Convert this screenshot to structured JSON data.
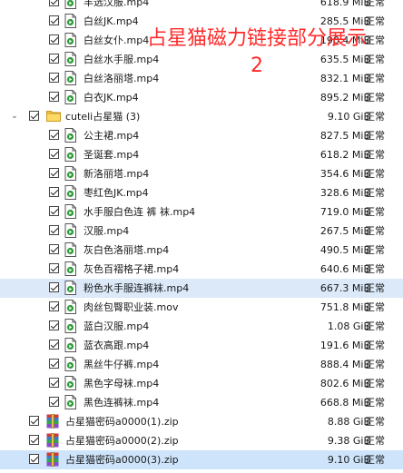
{
  "status_text": "正常",
  "watermark": {
    "line1": "占星猫磁力链接部分展示",
    "line2": "2"
  },
  "rows": [
    {
      "type": "file",
      "name": "丰选汉服.mp4",
      "size": "618.9 MiB"
    },
    {
      "type": "file",
      "name": "白丝JK.mp4",
      "size": "285.5 MiB"
    },
    {
      "type": "file",
      "name": "白丝女仆.mp4",
      "size": "190.4 MiB"
    },
    {
      "type": "file",
      "name": "白丝水手服.mp4",
      "size": "635.5 MiB"
    },
    {
      "type": "file",
      "name": "白丝洛丽塔.mp4",
      "size": "832.1 MiB"
    },
    {
      "type": "file",
      "name": "白衣JK.mp4",
      "size": "895.2 MiB"
    },
    {
      "type": "folder",
      "name": "cuteli占星猫 (3)",
      "size": "9.10 GiB"
    },
    {
      "type": "file",
      "name": "公主裙.mp4",
      "size": "827.5 MiB"
    },
    {
      "type": "file",
      "name": "圣诞套.mp4",
      "size": "618.2 MiB"
    },
    {
      "type": "file",
      "name": "新洛丽塔.mp4",
      "size": "354.6 MiB"
    },
    {
      "type": "file",
      "name": "枣红色JK.mp4",
      "size": "328.6 MiB"
    },
    {
      "type": "file",
      "name": "水手服白色连 裤 袜.mp4",
      "size": "719.0 MiB"
    },
    {
      "type": "file",
      "name": "汉服.mp4",
      "size": "267.5 MiB"
    },
    {
      "type": "file",
      "name": "灰白色洛丽塔.mp4",
      "size": "490.5 MiB"
    },
    {
      "type": "file",
      "name": "灰色百褶格子裙.mp4",
      "size": "640.6 MiB"
    },
    {
      "type": "file",
      "name": "粉色水手服连裤袜.mp4",
      "size": "667.3 MiB",
      "highlight": true
    },
    {
      "type": "file",
      "name": "肉丝包臀职业装.mov",
      "size": "751.8 MiB"
    },
    {
      "type": "file",
      "name": "蓝白汉服.mp4",
      "size": "1.08 GiB"
    },
    {
      "type": "file",
      "name": "蓝衣高跟.mp4",
      "size": "191.6 MiB"
    },
    {
      "type": "file",
      "name": "黑丝牛仔裤.mp4",
      "size": "888.4 MiB"
    },
    {
      "type": "file",
      "name": "黑色字母袜.mp4",
      "size": "802.6 MiB"
    },
    {
      "type": "file",
      "name": "黑色连裤袜.mp4",
      "size": "668.8 MiB"
    },
    {
      "type": "zip",
      "name": "占星猫密码a0000(1).zip",
      "size": "8.88 GiB"
    },
    {
      "type": "zip",
      "name": "占星猫密码a0000(2).zip",
      "size": "9.38 GiB"
    },
    {
      "type": "zip",
      "name": "占星猫密码a0000(3).zip",
      "size": "9.10 GiB",
      "selected": true
    }
  ],
  "icons": {
    "file": "video-file-icon",
    "folder": "folder-icon",
    "zip": "zip-archive-icon",
    "chevron": "chevron-down-icon",
    "check": "checkbox-checked-icon"
  },
  "colors": {
    "watermark": "#ff2a2a",
    "highlight": "#dbe9f9",
    "selected": "#cde4fb",
    "folder": "#f5c74a",
    "file_icon": "#2e9b3a"
  }
}
